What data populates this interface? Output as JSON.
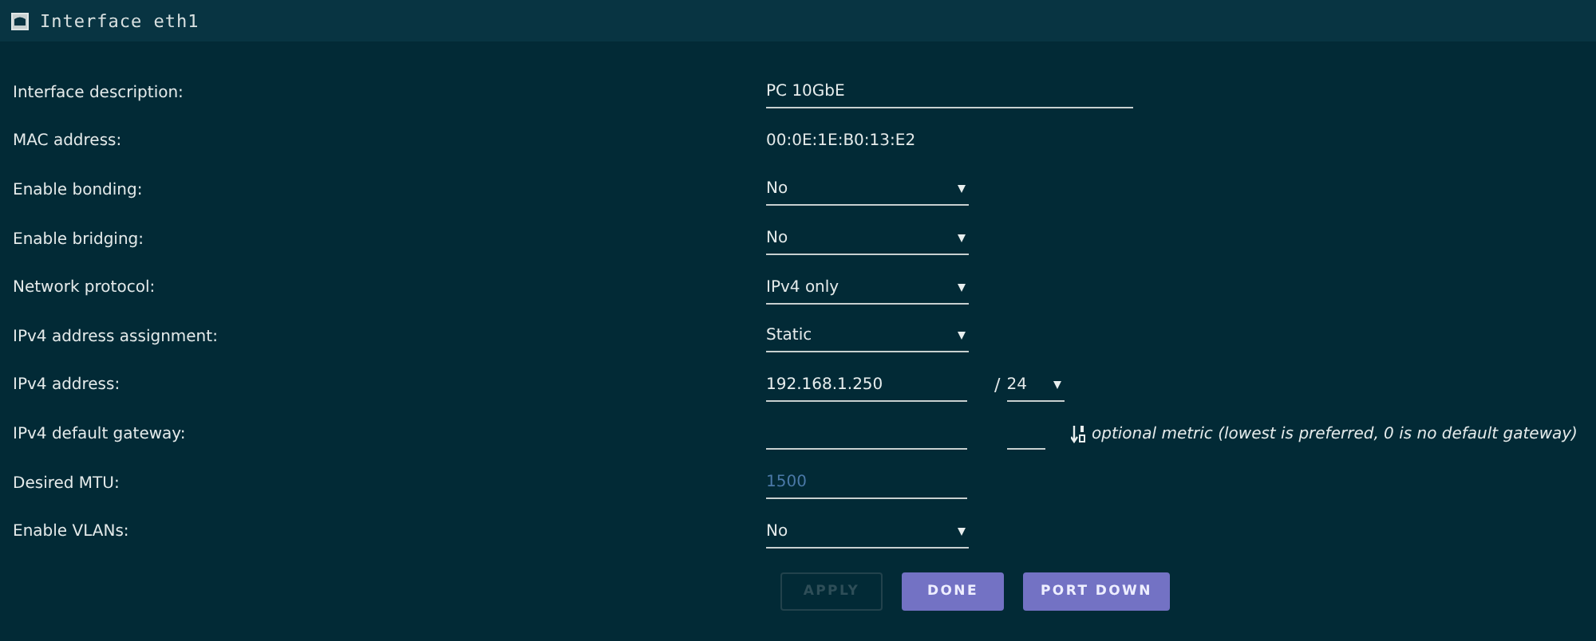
{
  "window": {
    "title": "Interface eth1"
  },
  "fields": [
    {
      "kind": "text",
      "label": "Interface description:",
      "value": "PC 10GbE"
    },
    {
      "kind": "static",
      "label": "MAC address:",
      "value": "00:0E:1E:B0:13:E2"
    },
    {
      "kind": "select",
      "label": "Enable bonding:",
      "value": "No"
    },
    {
      "kind": "select",
      "label": "Enable bridging:",
      "value": "No"
    },
    {
      "kind": "select",
      "label": "Network protocol:",
      "value": "IPv4 only"
    },
    {
      "kind": "select",
      "label": "IPv4 address assignment:",
      "value": "Static"
    },
    {
      "kind": "address",
      "label": "IPv4 address:",
      "value": "192.168.1.250",
      "separator": "/",
      "prefix": "24"
    },
    {
      "kind": "gateway",
      "label": "IPv4 default gateway:",
      "hint": "optional metric (lowest is preferred, 0 is no default gateway)"
    },
    {
      "kind": "number",
      "label": "Desired MTU:",
      "placeholder": "1500"
    },
    {
      "kind": "select",
      "label": "Enable VLANs:",
      "value": "No"
    }
  ],
  "buttons": [
    {
      "label": "APPLY",
      "disabled": true
    },
    {
      "label": "DONE",
      "disabled": false
    },
    {
      "label": "PORT DOWN",
      "disabled": false
    }
  ]
}
